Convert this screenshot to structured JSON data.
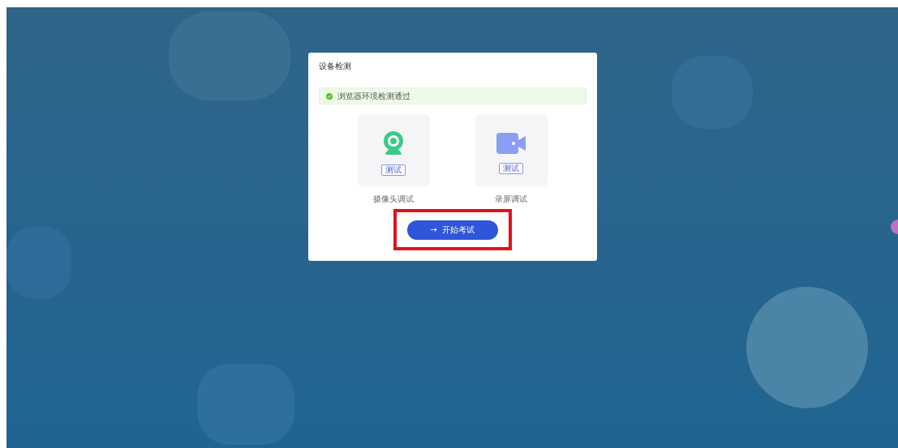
{
  "dialog": {
    "title": "设备检测",
    "notice": {
      "text": "浏览器环境检测通过",
      "passed": true
    },
    "devices": [
      {
        "kind": "camera",
        "button": "测试",
        "label": "摄像头调试"
      },
      {
        "kind": "screen",
        "button": "测试",
        "label": "录屏调试"
      }
    ],
    "start_button": {
      "arrow": "→",
      "label": "开始考试",
      "highlighted": true
    }
  }
}
